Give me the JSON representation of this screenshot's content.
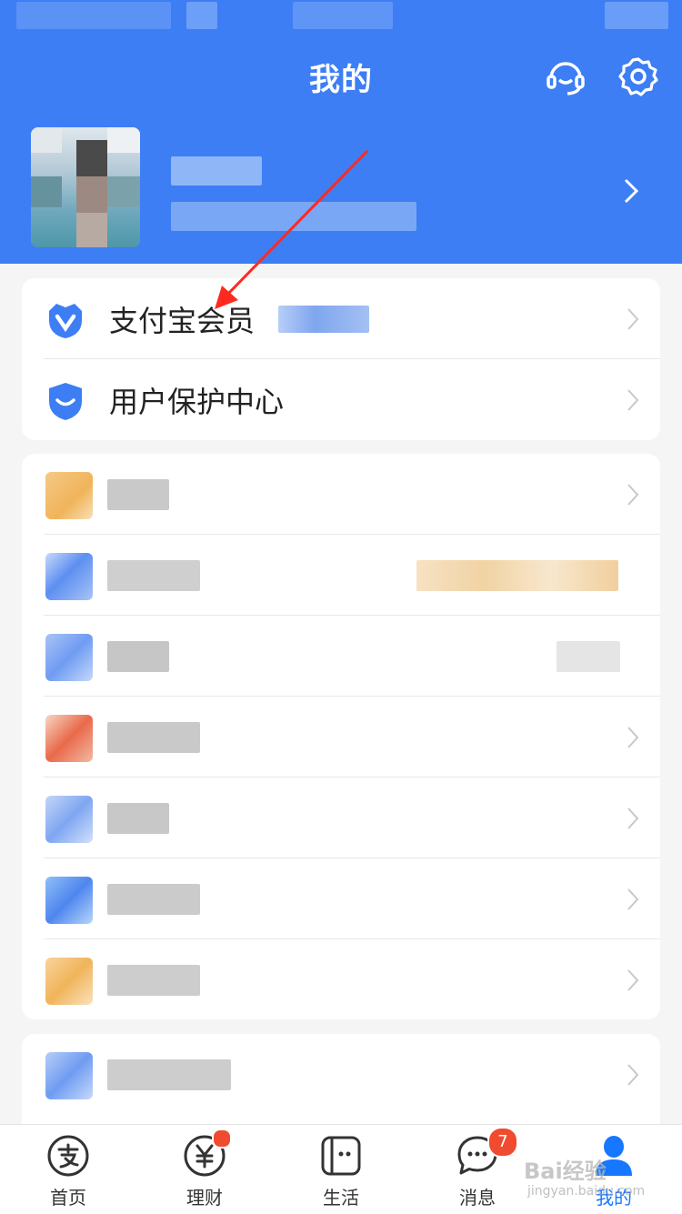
{
  "header": {
    "title": "我的",
    "icons": [
      "customer-service-icon",
      "settings-icon"
    ]
  },
  "profile": {
    "arrow_icon": "chevron-right-icon"
  },
  "card1": {
    "items": [
      {
        "label": "支付宝会员",
        "icon": "member-shield-icon"
      },
      {
        "label": "用户保护中心",
        "icon": "protection-shield-icon"
      }
    ]
  },
  "tabbar": {
    "tabs": [
      {
        "label": "首页",
        "icon": "alipay-icon"
      },
      {
        "label": "理财",
        "icon": "yuan-icon",
        "badge": "dot"
      },
      {
        "label": "生活",
        "icon": "life-icon"
      },
      {
        "label": "消息",
        "icon": "message-icon",
        "badge": "7"
      },
      {
        "label": "我的",
        "icon": "user-icon",
        "active": true
      }
    ]
  },
  "watermark": {
    "text": "Bai经验",
    "sub": "jingyan.baidu.com"
  },
  "colors": {
    "primary": "#3d7ef5",
    "badge": "#f04b2f",
    "active_tab": "#1677ff"
  }
}
